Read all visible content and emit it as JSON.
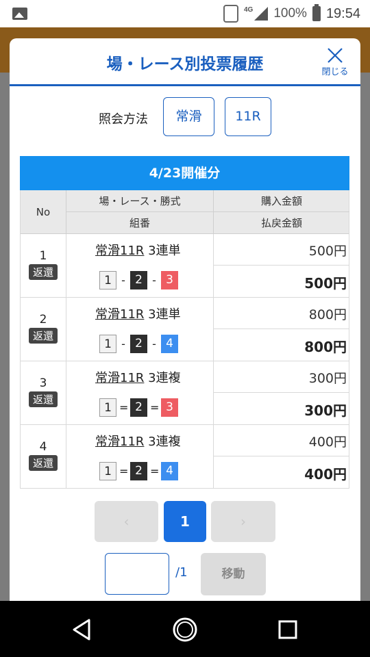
{
  "status_bar": {
    "network": "4G",
    "battery": "100%",
    "time": "19:54"
  },
  "modal": {
    "title": "場・レース別投票履歴",
    "close_label": "閉じる",
    "method_label": "照会方法",
    "venue_button": "常滑",
    "race_button": "11R",
    "date_header": "4/23開催分"
  },
  "table": {
    "headers": {
      "no": "No",
      "race": "場・レース・勝式",
      "combo": "組番",
      "purchase": "購入金額",
      "payout": "払戻金額"
    },
    "rows": [
      {
        "no": "1",
        "status": "返還",
        "venue_race": "常滑11R",
        "bet_type": "3連単",
        "boats": [
          "1",
          "2",
          "3"
        ],
        "sep": "-",
        "purchase": "500円",
        "payout": "500円"
      },
      {
        "no": "2",
        "status": "返還",
        "venue_race": "常滑11R",
        "bet_type": "3連単",
        "boats": [
          "1",
          "2",
          "4"
        ],
        "sep": "-",
        "purchase": "800円",
        "payout": "800円"
      },
      {
        "no": "3",
        "status": "返還",
        "venue_race": "常滑11R",
        "bet_type": "3連複",
        "boats": [
          "1",
          "2",
          "3"
        ],
        "sep": "=",
        "purchase": "300円",
        "payout": "300円"
      },
      {
        "no": "4",
        "status": "返還",
        "venue_race": "常滑11R",
        "bet_type": "3連複",
        "boats": [
          "1",
          "2",
          "4"
        ],
        "sep": "=",
        "purchase": "400円",
        "payout": "400円"
      }
    ]
  },
  "pagination": {
    "prev": "‹",
    "current": "1",
    "next": "›",
    "total": "/1",
    "jump_button": "移動",
    "jump_value": ""
  },
  "colors": {
    "brand_blue": "#1a5fbf",
    "date_bar": "#1490ee",
    "boat_1": "#f2f2f2",
    "boat_2": "#2e2e2e",
    "boat_3": "#ee5c62",
    "boat_4": "#3c8ef0"
  }
}
